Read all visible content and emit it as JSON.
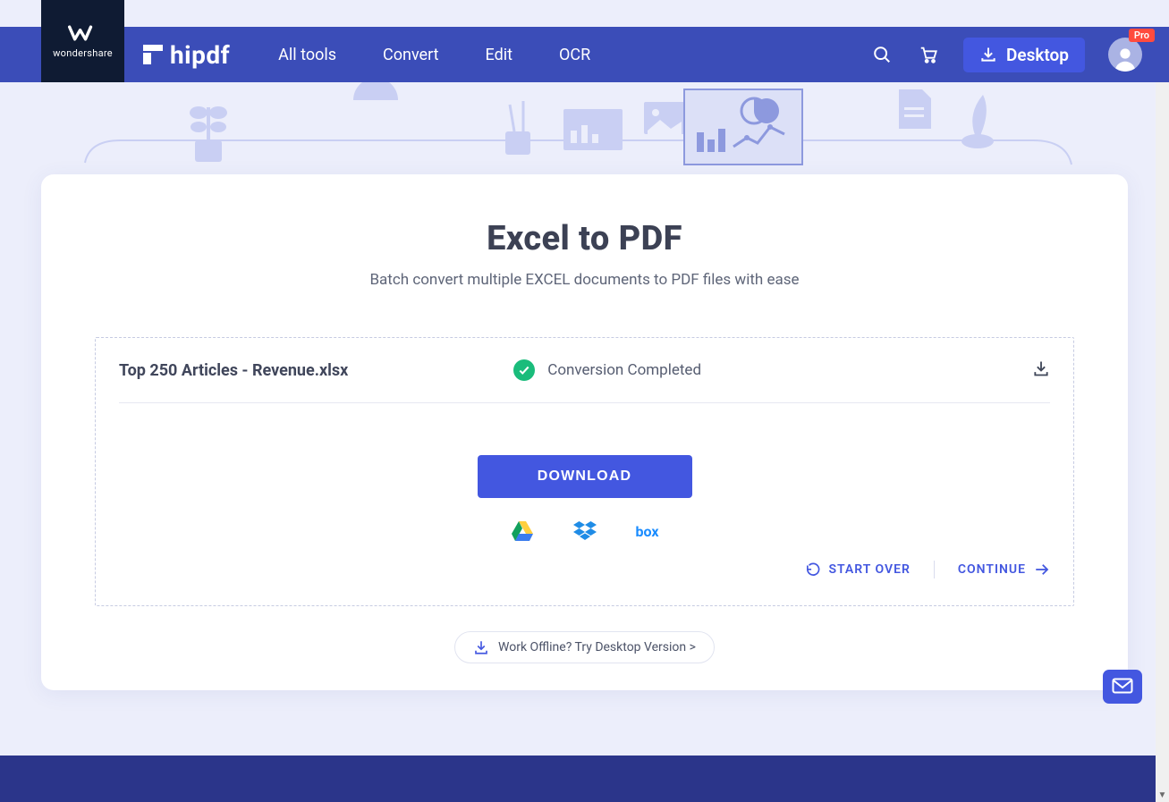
{
  "brand": {
    "parent": "wondershare",
    "product": "hipdf"
  },
  "nav": {
    "items": [
      "All tools",
      "Convert",
      "Edit",
      "OCR"
    ],
    "desktop_label": "Desktop",
    "pro_badge": "Pro"
  },
  "page": {
    "title": "Excel to PDF",
    "subtitle": "Batch convert multiple EXCEL documents to PDF files with ease"
  },
  "file": {
    "name": "Top 250 Articles - Revenue.xlsx",
    "status": "Conversion Completed"
  },
  "buttons": {
    "download": "DOWNLOAD",
    "start_over": "START OVER",
    "continue": "CONTINUE",
    "offline": "Work Offline? Try Desktop Version >"
  },
  "clouds": {
    "box_label": "box"
  },
  "colors": {
    "primary": "#4357e0",
    "navbar": "#3b4db8",
    "success": "#1abc7b",
    "text": "#3c4154"
  }
}
